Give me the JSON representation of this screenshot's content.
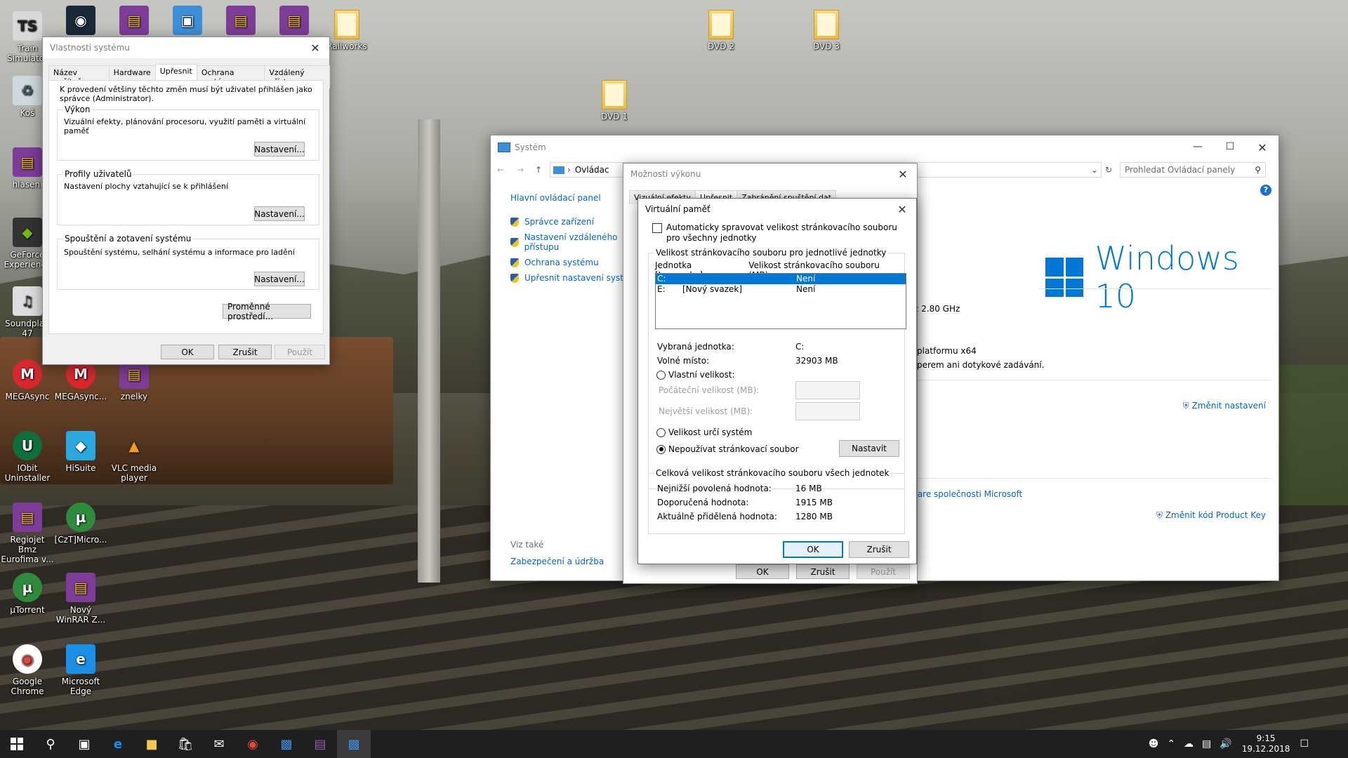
{
  "desktop_icons": [
    {
      "label": "Train Simulator",
      "name": "train-simulator-icon",
      "kind": "ts"
    },
    {
      "label": "",
      "name": "steam-icon",
      "kind": "steam"
    },
    {
      "label": "",
      "name": "winrar-icon-1",
      "kind": "rar"
    },
    {
      "label": "",
      "name": "network-icon",
      "kind": "net"
    },
    {
      "label": "",
      "name": "winrar-icon-2",
      "kind": "rar"
    },
    {
      "label": "",
      "name": "winrar-icon-3",
      "kind": "rar"
    },
    {
      "label": "Railworks",
      "name": "railworks-folder-icon",
      "kind": "folder"
    },
    {
      "label": "DVD 2",
      "name": "dvd2-folder-icon",
      "kind": "folder"
    },
    {
      "label": "DVD 3",
      "name": "dvd3-folder-icon",
      "kind": "folder"
    },
    {
      "label": "DVD 1",
      "name": "dvd1-folder-icon",
      "kind": "folder"
    },
    {
      "label": "Koš",
      "name": "recycle-bin-icon",
      "kind": "bin"
    },
    {
      "label": "hlaseni",
      "name": "hlaseni-icon",
      "kind": "rar"
    },
    {
      "label": "GeForce Experience",
      "name": "geforce-icon",
      "kind": "geforce"
    },
    {
      "label": "Soundplan 47",
      "name": "soundplan-icon",
      "kind": "sound"
    },
    {
      "label": "MEGAsync",
      "name": "megasync-icon",
      "kind": "mega"
    },
    {
      "label": "MEGAsync...",
      "name": "megasync-2-icon",
      "kind": "mega"
    },
    {
      "label": "znelky",
      "name": "znelky-icon",
      "kind": "rar"
    },
    {
      "label": "IObit Uninstaller",
      "name": "iobit-icon",
      "kind": "iobit"
    },
    {
      "label": "HiSuite",
      "name": "hisuite-icon",
      "kind": "hisuite"
    },
    {
      "label": "VLC media player",
      "name": "vlc-icon",
      "kind": "vlc"
    },
    {
      "label": "Regiojet Bmz Eurofima v...",
      "name": "regiojet-icon",
      "kind": "rar"
    },
    {
      "label": "[CzT]Micro...",
      "name": "czt-micro-icon",
      "kind": "utorrent"
    },
    {
      "label": "µTorrent",
      "name": "utorrent-icon",
      "kind": "utorrent"
    },
    {
      "label": "Nový WinRAR Z...",
      "name": "new-winrar-icon",
      "kind": "rar"
    },
    {
      "label": "Google Chrome",
      "name": "chrome-icon",
      "kind": "chrome"
    },
    {
      "label": "Microsoft Edge",
      "name": "edge-icon",
      "kind": "edge"
    }
  ],
  "sysprops": {
    "title": "Vlastnosti systému",
    "tabs": [
      "Název počítače",
      "Hardware",
      "Upřesnit",
      "Ochrana systému",
      "Vzdálený přístup"
    ],
    "admin_note": "K provedení většiny těchto změn musí být uživatel přihlášen jako správce (Administrator).",
    "perf_title": "Výkon",
    "perf_desc": "Vizuální efekty, plánování procesoru, využití paměti a virtuální paměť",
    "profiles_title": "Profily uživatelů",
    "profiles_desc": "Nastavení plochy vztahující se k přihlášení",
    "startup_title": "Spouštění a zotavení systému",
    "startup_desc": "Spouštění systému, selhání systému a informace pro ladění",
    "settings_btn": "Nastavení...",
    "env_btn": "Proměnné prostředí...",
    "ok": "OK",
    "cancel": "Zrušit",
    "apply": "Použít"
  },
  "system": {
    "title": "Systém",
    "breadcrumb": "Ovládac",
    "search_placeholder": "Prohledat Ovládací panely",
    "home_link": "Hlavní ovládací panel",
    "links": [
      "Správce zařízení",
      "Nastavení vzdáleného přístupu",
      "Ochrana systému",
      "Upřesnit nastavení systému"
    ],
    "see_also": "Viz také",
    "security_link": "Zabezpečení a údržba",
    "win10": "Windows 10",
    "cpu_speed": "z  2.80 GHz",
    "platform": "platformu x64",
    "pen": "perem ani dotykové zadávání.",
    "change_settings": "Změnit nastavení",
    "ms_link": "ware společnosti Microsoft",
    "change_key": "Změnit kód Product Key"
  },
  "perfopts": {
    "title": "Možnosti výkonu",
    "tabs": [
      "Vizuální efekty",
      "Upřesnit",
      "Zabránění spuštění dat"
    ],
    "ok": "OK",
    "cancel": "Zrušit",
    "apply": "Použít"
  },
  "vmem": {
    "title": "Virtuální paměť",
    "auto_manage": "Automaticky spravovat velikost stránkovacího souboru pro všechny jednotky",
    "group_title": "Velikost stránkovacího souboru pro jednotlivé jednotky",
    "col_drive": "Jednotka [Jmenovka]",
    "col_size": "Velikost stránkovacího souboru (MB)",
    "drives": [
      {
        "drive": "C:",
        "label": "",
        "size": "Není"
      },
      {
        "drive": "E:",
        "label": "[Nový svazek]",
        "size": "Není"
      }
    ],
    "selected_drive_label": "Vybraná jednotka:",
    "selected_drive": "C:",
    "free_label": "Volné místo:",
    "free_value": "32903 MB",
    "custom_size": "Vlastní velikost:",
    "initial_size": "Počáteční velikost (MB):",
    "max_size": "Největší velikost (MB):",
    "system_managed": "Velikost určí systém",
    "no_paging": "Nepoužívat stránkovací soubor",
    "set_btn": "Nastavit",
    "total_title": "Celková velikost stránkovacího souboru všech jednotek",
    "min_label": "Nejnižší povolená hodnota:",
    "min_value": "16 MB",
    "rec_label": "Doporučená hodnota:",
    "rec_value": "1915 MB",
    "cur_label": "Aktuálně přidělená hodnota:",
    "cur_value": "1280 MB",
    "ok": "OK",
    "cancel": "Zrušit"
  },
  "taskbar": {
    "time": "9:15",
    "date": "19.12.2018"
  },
  "colors": {
    "accent": "#0078d7",
    "link": "#0066cc",
    "taskbar": "#1f1f1f"
  }
}
